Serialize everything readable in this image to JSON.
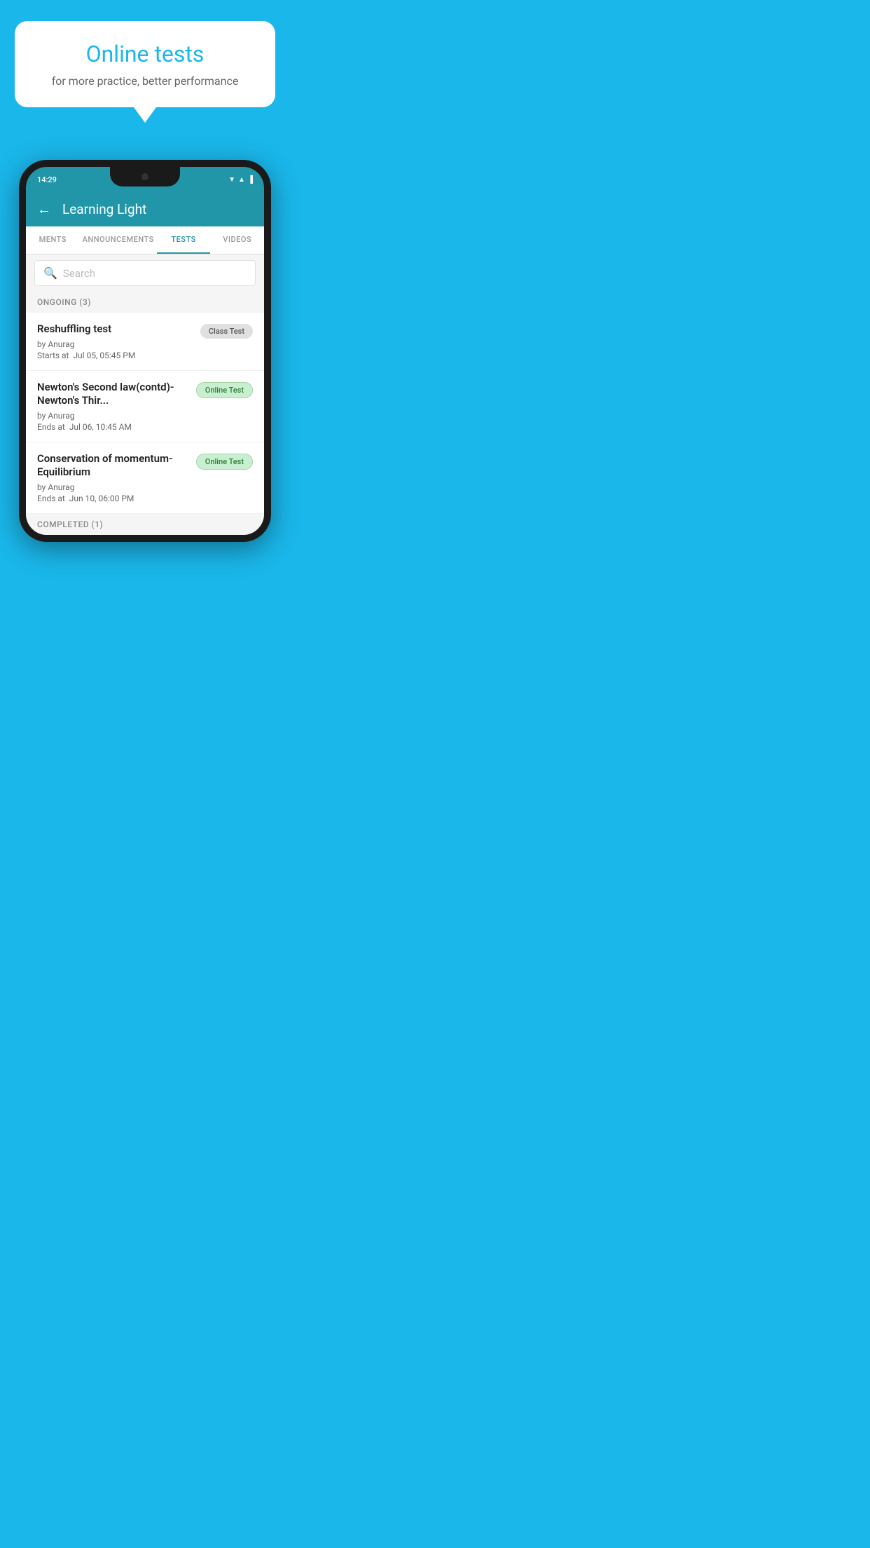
{
  "background_color": "#1ab7ea",
  "speech_bubble": {
    "title": "Online tests",
    "subtitle": "for more practice, better performance"
  },
  "phone": {
    "status_bar": {
      "time": "14:29"
    },
    "app_bar": {
      "title": "Learning Light",
      "back_label": "←"
    },
    "tabs": [
      {
        "label": "MENTS",
        "active": false
      },
      {
        "label": "ANNOUNCEMENTS",
        "active": false
      },
      {
        "label": "TESTS",
        "active": true
      },
      {
        "label": "VIDEOS",
        "active": false
      }
    ],
    "search": {
      "placeholder": "Search"
    },
    "ongoing_section": {
      "label": "ONGOING (3)"
    },
    "tests": [
      {
        "name": "Reshuffling test",
        "author": "by Anurag",
        "time_label": "Starts at",
        "time": "Jul 05, 05:45 PM",
        "badge": "Class Test",
        "badge_type": "class"
      },
      {
        "name": "Newton's Second law(contd)-Newton's Thir...",
        "author": "by Anurag",
        "time_label": "Ends at",
        "time": "Jul 06, 10:45 AM",
        "badge": "Online Test",
        "badge_type": "online"
      },
      {
        "name": "Conservation of momentum-Equilibrium",
        "author": "by Anurag",
        "time_label": "Ends at",
        "time": "Jun 10, 06:00 PM",
        "badge": "Online Test",
        "badge_type": "online"
      }
    ],
    "completed_section": {
      "label": "COMPLETED (1)"
    }
  }
}
